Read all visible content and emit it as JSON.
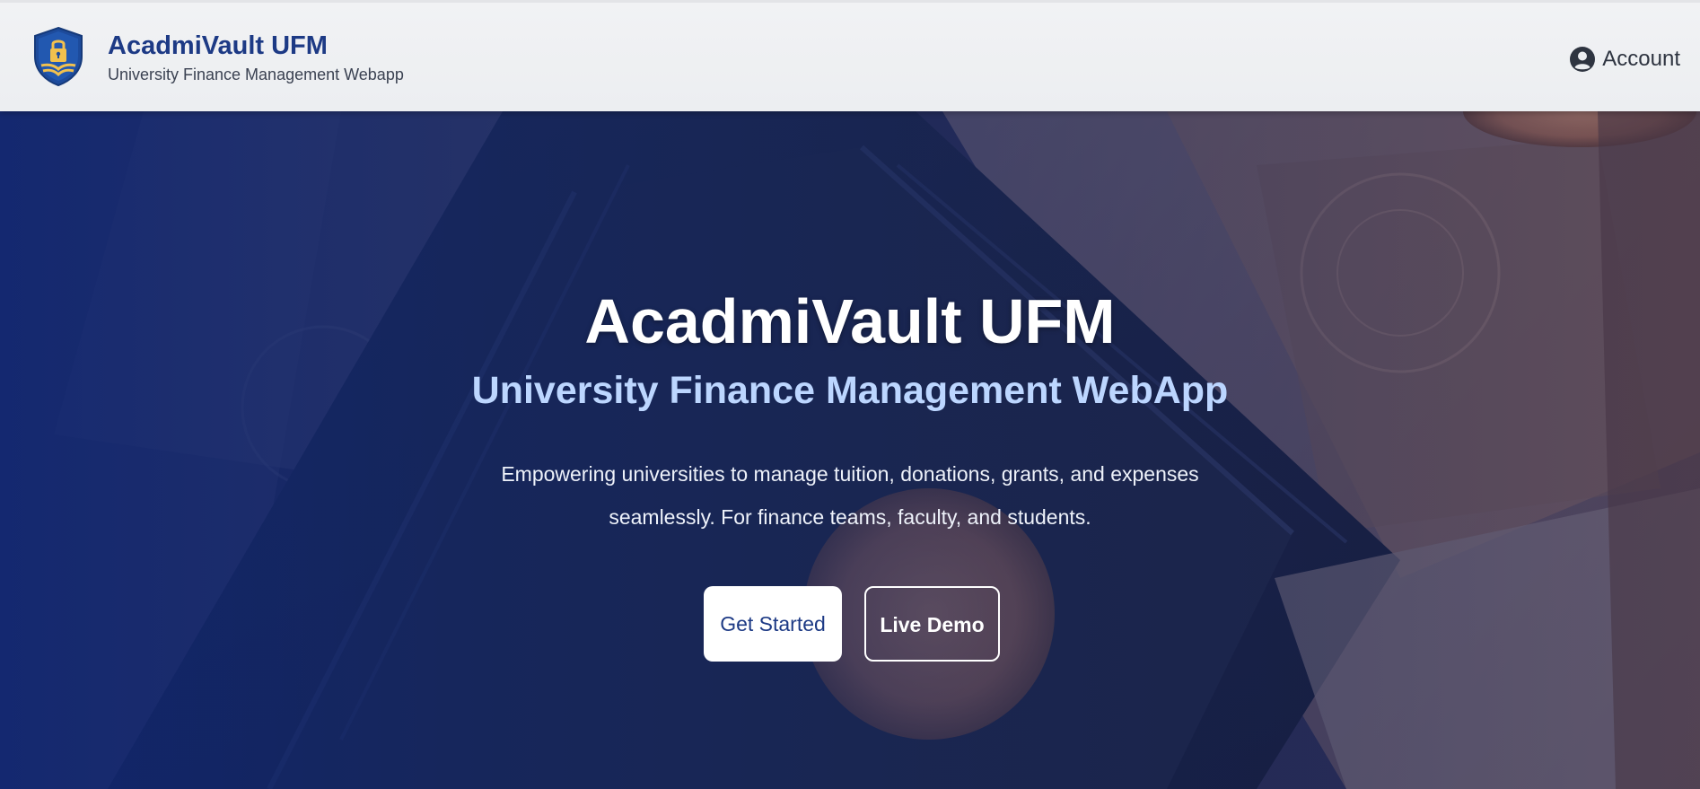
{
  "header": {
    "brand_title": "AcadmiVault UFM",
    "brand_subtitle": "University Finance Management Webapp",
    "logo_icon": "shield-lock-book-icon",
    "account_icon": "user-circle-icon",
    "account_label": "Account"
  },
  "hero": {
    "title": "AcadmiVault UFM",
    "subtitle": "University Finance Management WebApp",
    "description": "Empowering universities to manage tuition, donations, grants, and expenses seamlessly. For finance teams, faculty, and students.",
    "primary_button": "Get Started",
    "secondary_button": "Live Demo",
    "background_image": "wallet-coins-banknotes-photo"
  },
  "colors": {
    "brand_blue": "#1d3a85",
    "subtitle_blue": "#bcd6ff",
    "gold": "#f2c14e",
    "header_bg": "#eceef1"
  }
}
